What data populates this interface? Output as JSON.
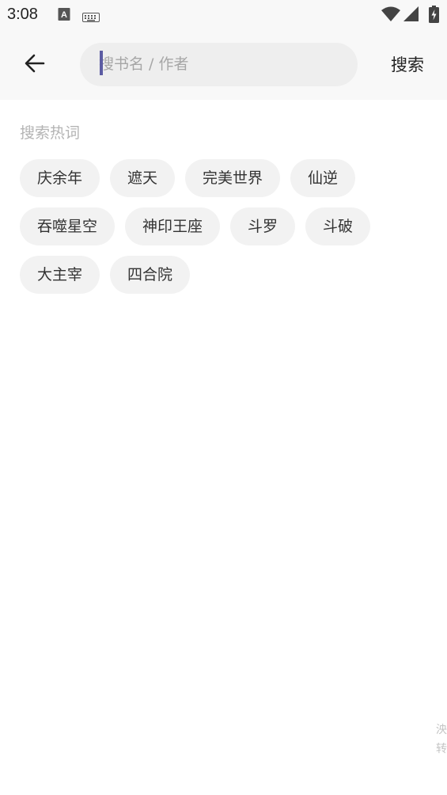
{
  "status_bar": {
    "time": "3:08",
    "icons": [
      "text-a-icon",
      "keyboard-icon",
      "wifi-icon",
      "signal-icon",
      "battery-charging-icon"
    ]
  },
  "header": {
    "back_icon": "arrow-left-icon",
    "search_placeholder": "搜书名 / 作者",
    "search_value": "",
    "search_button": "搜索"
  },
  "hot": {
    "title": "搜索热词",
    "tags": [
      "庆余年",
      "遮天",
      "完美世界",
      "仙逆",
      "吞噬星空",
      "神印王座",
      "斗罗",
      "斗破",
      "大主宰",
      "四合院"
    ]
  },
  "side": {
    "chars": [
      "泱",
      "转"
    ]
  },
  "colors": {
    "bar_bg": "#f8f8f8",
    "tag_bg": "#f2f2f2",
    "caret": "#5c5ca3",
    "muted": "#b4b4b4"
  }
}
